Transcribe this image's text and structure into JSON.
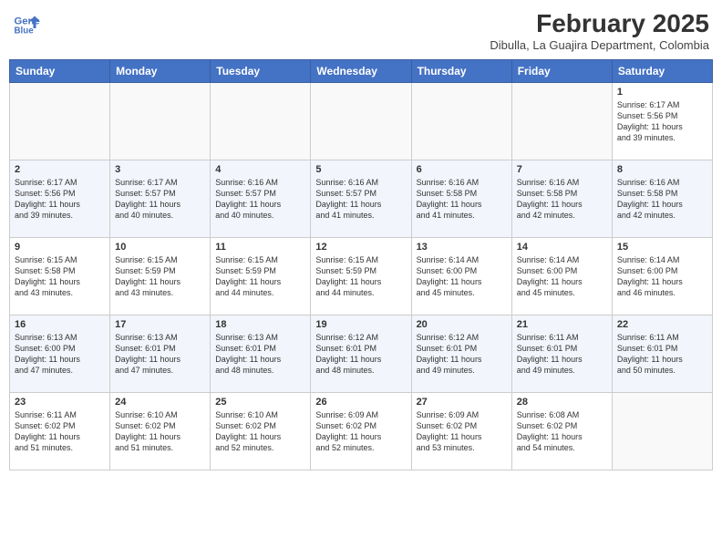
{
  "header": {
    "logo_line1": "General",
    "logo_line2": "Blue",
    "title": "February 2025",
    "subtitle": "Dibulla, La Guajira Department, Colombia"
  },
  "days_of_week": [
    "Sunday",
    "Monday",
    "Tuesday",
    "Wednesday",
    "Thursday",
    "Friday",
    "Saturday"
  ],
  "weeks": [
    [
      {
        "day": "",
        "info": ""
      },
      {
        "day": "",
        "info": ""
      },
      {
        "day": "",
        "info": ""
      },
      {
        "day": "",
        "info": ""
      },
      {
        "day": "",
        "info": ""
      },
      {
        "day": "",
        "info": ""
      },
      {
        "day": "1",
        "info": "Sunrise: 6:17 AM\nSunset: 5:56 PM\nDaylight: 11 hours\nand 39 minutes."
      }
    ],
    [
      {
        "day": "2",
        "info": "Sunrise: 6:17 AM\nSunset: 5:56 PM\nDaylight: 11 hours\nand 39 minutes."
      },
      {
        "day": "3",
        "info": "Sunrise: 6:17 AM\nSunset: 5:57 PM\nDaylight: 11 hours\nand 40 minutes."
      },
      {
        "day": "4",
        "info": "Sunrise: 6:16 AM\nSunset: 5:57 PM\nDaylight: 11 hours\nand 40 minutes."
      },
      {
        "day": "5",
        "info": "Sunrise: 6:16 AM\nSunset: 5:57 PM\nDaylight: 11 hours\nand 41 minutes."
      },
      {
        "day": "6",
        "info": "Sunrise: 6:16 AM\nSunset: 5:58 PM\nDaylight: 11 hours\nand 41 minutes."
      },
      {
        "day": "7",
        "info": "Sunrise: 6:16 AM\nSunset: 5:58 PM\nDaylight: 11 hours\nand 42 minutes."
      },
      {
        "day": "8",
        "info": "Sunrise: 6:16 AM\nSunset: 5:58 PM\nDaylight: 11 hours\nand 42 minutes."
      }
    ],
    [
      {
        "day": "9",
        "info": "Sunrise: 6:15 AM\nSunset: 5:58 PM\nDaylight: 11 hours\nand 43 minutes."
      },
      {
        "day": "10",
        "info": "Sunrise: 6:15 AM\nSunset: 5:59 PM\nDaylight: 11 hours\nand 43 minutes."
      },
      {
        "day": "11",
        "info": "Sunrise: 6:15 AM\nSunset: 5:59 PM\nDaylight: 11 hours\nand 44 minutes."
      },
      {
        "day": "12",
        "info": "Sunrise: 6:15 AM\nSunset: 5:59 PM\nDaylight: 11 hours\nand 44 minutes."
      },
      {
        "day": "13",
        "info": "Sunrise: 6:14 AM\nSunset: 6:00 PM\nDaylight: 11 hours\nand 45 minutes."
      },
      {
        "day": "14",
        "info": "Sunrise: 6:14 AM\nSunset: 6:00 PM\nDaylight: 11 hours\nand 45 minutes."
      },
      {
        "day": "15",
        "info": "Sunrise: 6:14 AM\nSunset: 6:00 PM\nDaylight: 11 hours\nand 46 minutes."
      }
    ],
    [
      {
        "day": "16",
        "info": "Sunrise: 6:13 AM\nSunset: 6:00 PM\nDaylight: 11 hours\nand 47 minutes."
      },
      {
        "day": "17",
        "info": "Sunrise: 6:13 AM\nSunset: 6:01 PM\nDaylight: 11 hours\nand 47 minutes."
      },
      {
        "day": "18",
        "info": "Sunrise: 6:13 AM\nSunset: 6:01 PM\nDaylight: 11 hours\nand 48 minutes."
      },
      {
        "day": "19",
        "info": "Sunrise: 6:12 AM\nSunset: 6:01 PM\nDaylight: 11 hours\nand 48 minutes."
      },
      {
        "day": "20",
        "info": "Sunrise: 6:12 AM\nSunset: 6:01 PM\nDaylight: 11 hours\nand 49 minutes."
      },
      {
        "day": "21",
        "info": "Sunrise: 6:11 AM\nSunset: 6:01 PM\nDaylight: 11 hours\nand 49 minutes."
      },
      {
        "day": "22",
        "info": "Sunrise: 6:11 AM\nSunset: 6:01 PM\nDaylight: 11 hours\nand 50 minutes."
      }
    ],
    [
      {
        "day": "23",
        "info": "Sunrise: 6:11 AM\nSunset: 6:02 PM\nDaylight: 11 hours\nand 51 minutes."
      },
      {
        "day": "24",
        "info": "Sunrise: 6:10 AM\nSunset: 6:02 PM\nDaylight: 11 hours\nand 51 minutes."
      },
      {
        "day": "25",
        "info": "Sunrise: 6:10 AM\nSunset: 6:02 PM\nDaylight: 11 hours\nand 52 minutes."
      },
      {
        "day": "26",
        "info": "Sunrise: 6:09 AM\nSunset: 6:02 PM\nDaylight: 11 hours\nand 52 minutes."
      },
      {
        "day": "27",
        "info": "Sunrise: 6:09 AM\nSunset: 6:02 PM\nDaylight: 11 hours\nand 53 minutes."
      },
      {
        "day": "28",
        "info": "Sunrise: 6:08 AM\nSunset: 6:02 PM\nDaylight: 11 hours\nand 54 minutes."
      },
      {
        "day": "",
        "info": ""
      }
    ]
  ]
}
